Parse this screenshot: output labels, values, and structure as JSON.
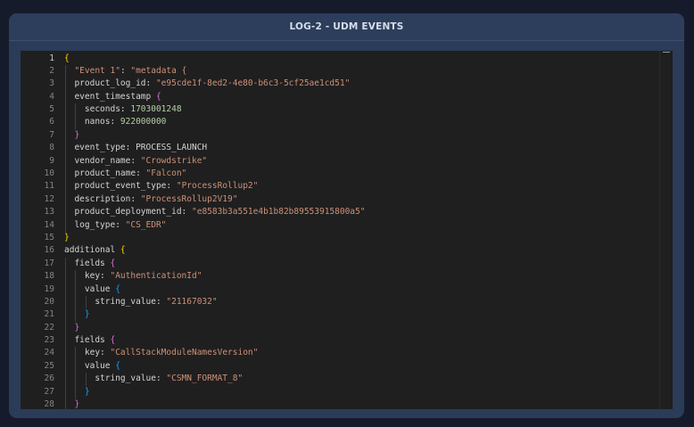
{
  "header": {
    "title": "LOG-2 - UDM EVENTS"
  },
  "editor": {
    "active_line": 1,
    "lines": [
      [
        {
          "t": "{",
          "c": "b1"
        }
      ],
      [
        {
          "t": "  "
        },
        {
          "t": "\"Event 1\"",
          "c": "s"
        },
        {
          "t": ": "
        },
        {
          "t": "\"metadata {",
          "c": "s"
        }
      ],
      [
        {
          "t": "  product_log_id: "
        },
        {
          "t": "\"e95cde1f-8ed2-4e80-b6c3-5cf25ae1cd51\"",
          "c": "s"
        }
      ],
      [
        {
          "t": "  event_timestamp "
        },
        {
          "t": "{",
          "c": "b2"
        }
      ],
      [
        {
          "t": "    seconds: "
        },
        {
          "t": "1703001248",
          "c": "n"
        }
      ],
      [
        {
          "t": "    nanos: "
        },
        {
          "t": "922000000",
          "c": "n"
        }
      ],
      [
        {
          "t": "  "
        },
        {
          "t": "}",
          "c": "b2"
        }
      ],
      [
        {
          "t": "  event_type: PROCESS_LAUNCH"
        }
      ],
      [
        {
          "t": "  vendor_name: "
        },
        {
          "t": "\"Crowdstrike\"",
          "c": "s"
        }
      ],
      [
        {
          "t": "  product_name: "
        },
        {
          "t": "\"Falcon\"",
          "c": "s"
        }
      ],
      [
        {
          "t": "  product_event_type: "
        },
        {
          "t": "\"ProcessRollup2\"",
          "c": "s"
        }
      ],
      [
        {
          "t": "  description: "
        },
        {
          "t": "\"ProcessRollup2V19\"",
          "c": "s"
        }
      ],
      [
        {
          "t": "  product_deployment_id: "
        },
        {
          "t": "\"e8583b3a551e4b1b82b89553915800a5\"",
          "c": "s"
        }
      ],
      [
        {
          "t": "  log_type: "
        },
        {
          "t": "\"CS_EDR\"",
          "c": "s"
        }
      ],
      [
        {
          "t": "}",
          "c": "b1"
        }
      ],
      [
        {
          "t": "additional "
        },
        {
          "t": "{",
          "c": "b1"
        }
      ],
      [
        {
          "t": "  fields "
        },
        {
          "t": "{",
          "c": "b2"
        }
      ],
      [
        {
          "t": "    key: "
        },
        {
          "t": "\"AuthenticationId\"",
          "c": "s"
        }
      ],
      [
        {
          "t": "    value "
        },
        {
          "t": "{",
          "c": "b3"
        }
      ],
      [
        {
          "t": "      string_value: "
        },
        {
          "t": "\"21167032\"",
          "c": "s"
        }
      ],
      [
        {
          "t": "    "
        },
        {
          "t": "}",
          "c": "b3"
        }
      ],
      [
        {
          "t": "  "
        },
        {
          "t": "}",
          "c": "b2"
        }
      ],
      [
        {
          "t": "  fields "
        },
        {
          "t": "{",
          "c": "b2"
        }
      ],
      [
        {
          "t": "    key: "
        },
        {
          "t": "\"CallStackModuleNamesVersion\"",
          "c": "s"
        }
      ],
      [
        {
          "t": "    value "
        },
        {
          "t": "{",
          "c": "b3"
        }
      ],
      [
        {
          "t": "      string_value: "
        },
        {
          "t": "\"CSMN_FORMAT_8\"",
          "c": "s"
        }
      ],
      [
        {
          "t": "    "
        },
        {
          "t": "}",
          "c": "b3"
        }
      ],
      [
        {
          "t": "  "
        },
        {
          "t": "}",
          "c": "b2"
        }
      ]
    ]
  },
  "colors": {
    "page_bg": "#161b2b",
    "panel_bg": "#2b3c58",
    "editor_bg": "#1f1f1f",
    "string": "#ce9178",
    "number": "#b5cea8",
    "bracket_1": "#ffd700",
    "bracket_2": "#da70d6",
    "bracket_3": "#179fff"
  }
}
